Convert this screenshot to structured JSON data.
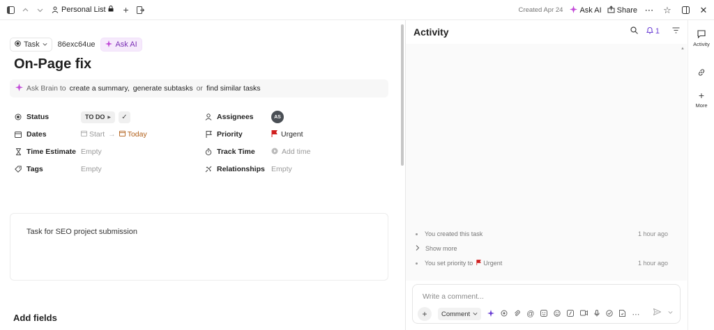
{
  "topbar": {
    "list_name": "Personal List",
    "created": "Created Apr 24",
    "ask_ai": "Ask AI",
    "share": "Share"
  },
  "task": {
    "type_label": "Task",
    "id": "86exc64ue",
    "ask_ai": "Ask AI",
    "title": "On-Page fix",
    "brain": {
      "prefix": "Ask Brain to",
      "action1": "create a summary",
      "sep1": ",",
      "action2": "generate subtasks",
      "sep2": "or",
      "action3": "find similar tasks"
    },
    "fields": {
      "status_label": "Status",
      "status_value": "TO DO",
      "dates_label": "Dates",
      "start": "Start",
      "today": "Today",
      "time_estimate_label": "Time Estimate",
      "time_estimate_value": "Empty",
      "tags_label": "Tags",
      "tags_value": "Empty",
      "assignees_label": "Assignees",
      "assignee_initials": "AS",
      "priority_label": "Priority",
      "priority_value": "Urgent",
      "track_time_label": "Track Time",
      "track_time_value": "Add time",
      "relationships_label": "Relationships",
      "relationships_value": "Empty"
    },
    "description": "Task for SEO project submission",
    "add_fields": "Add fields"
  },
  "activity": {
    "title": "Activity",
    "notif_count": "1",
    "events": [
      {
        "text": "You created this task",
        "time": "1 hour ago"
      },
      {
        "text": "Show more",
        "time": ""
      },
      {
        "text": "You set priority to",
        "extra": "Urgent",
        "time": "1 hour ago"
      }
    ],
    "comment_placeholder": "Write a comment...",
    "comment_type": "Comment"
  },
  "rail": {
    "activity": "Activity",
    "more": "More"
  },
  "colors": {
    "accent": "#6b3fd4",
    "urgent": "#d01f1f",
    "today": "#b05d16",
    "ai": "#7a2fb5"
  }
}
